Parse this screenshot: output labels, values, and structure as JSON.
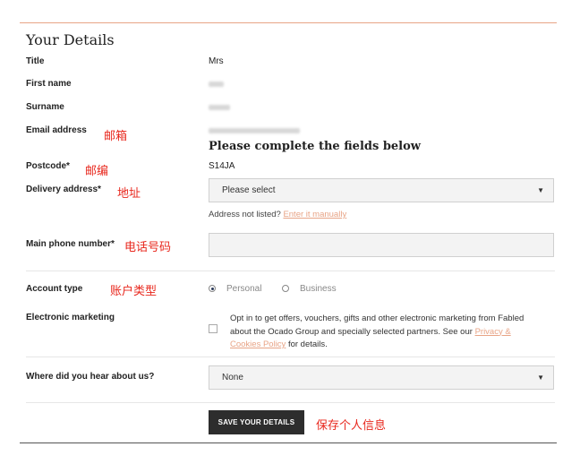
{
  "section_title": "Your Details",
  "fields": {
    "title": {
      "label": "Title",
      "value": "Mrs"
    },
    "first_name": {
      "label": "First name"
    },
    "surname": {
      "label": "Surname"
    },
    "email": {
      "label": "Email address"
    },
    "postcode": {
      "label": "Postcode*",
      "value": "S14JA"
    },
    "delivery": {
      "label": "Delivery address*",
      "placeholder": "Please select"
    },
    "phone": {
      "label": "Main phone number*"
    },
    "account_type": {
      "label": "Account type",
      "options": [
        "Personal",
        "Business"
      ],
      "selected": "Personal"
    },
    "marketing": {
      "label": "Electronic marketing",
      "text_before": "Opt in to get offers, vouchers, gifts and other electronic marketing from Fabled about the Ocado Group and specially selected partners. See our ",
      "link": "Privacy & Cookies Policy",
      "text_after": " for details.",
      "checked": false
    },
    "hear_about": {
      "label": "Where did you hear about us?",
      "value": "None"
    }
  },
  "complete_heading": "Please complete the fields below",
  "address_hint": {
    "text": "Address not listed? ",
    "link": "Enter it manually"
  },
  "save_button": "SAVE YOUR DETAILS",
  "annotations": {
    "email": "邮箱",
    "postcode": "邮编",
    "delivery": "地址",
    "phone": "电话号码",
    "account_type": "账户类型",
    "save": "保存个人信息"
  },
  "colors": {
    "accent": "#e8a486",
    "annotation": "#e8281e",
    "button": "#2d2d2d"
  }
}
